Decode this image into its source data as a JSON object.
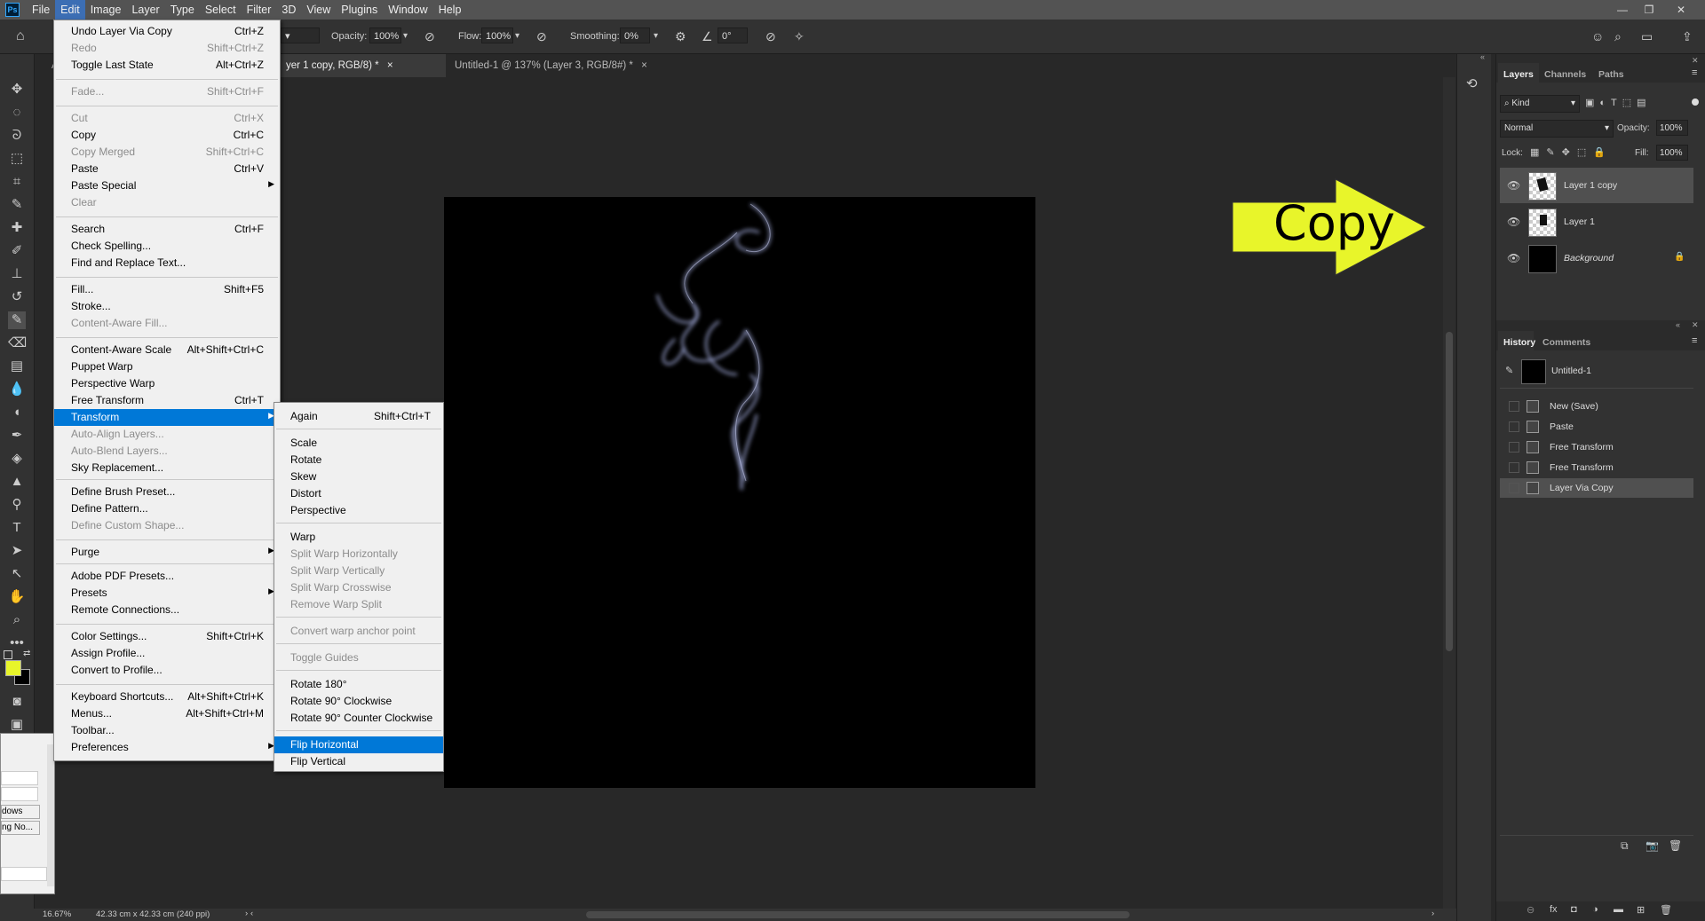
{
  "menubar": {
    "logo": "Ps",
    "items": [
      "File",
      "Edit",
      "Image",
      "Layer",
      "Type",
      "Select",
      "Filter",
      "3D",
      "View",
      "Plugins",
      "Window",
      "Help"
    ]
  },
  "options": {
    "opacity_label": "Opacity:",
    "opacity_value": "100%",
    "flow_label": "Flow:",
    "flow_value": "100%",
    "smoothing_label": "Smoothing:",
    "smoothing_value": "0%",
    "angle_value": "0°"
  },
  "tabs": [
    {
      "label": "A"
    },
    {
      "label": "yer 1 copy, RGB/8) *"
    },
    {
      "label": "Untitled-1 @ 137% (Layer 3, RGB/8#) *"
    }
  ],
  "edit_menu": {
    "items": [
      {
        "label": "Undo Layer Via Copy",
        "shortcut": "Ctrl+Z"
      },
      {
        "label": "Redo",
        "shortcut": "Shift+Ctrl+Z"
      },
      {
        "label": "Toggle Last State",
        "shortcut": "Alt+Ctrl+Z"
      },
      {
        "label": "Fade...",
        "shortcut": "Shift+Ctrl+F"
      },
      {
        "label": "Cut",
        "shortcut": "Ctrl+X"
      },
      {
        "label": "Copy",
        "shortcut": "Ctrl+C"
      },
      {
        "label": "Copy Merged",
        "shortcut": "Shift+Ctrl+C"
      },
      {
        "label": "Paste",
        "shortcut": "Ctrl+V"
      },
      {
        "label": "Paste Special",
        "shortcut": ""
      },
      {
        "label": "Clear",
        "shortcut": ""
      },
      {
        "label": "Search",
        "shortcut": "Ctrl+F"
      },
      {
        "label": "Check Spelling...",
        "shortcut": ""
      },
      {
        "label": "Find and Replace Text...",
        "shortcut": ""
      },
      {
        "label": "Fill...",
        "shortcut": "Shift+F5"
      },
      {
        "label": "Stroke...",
        "shortcut": ""
      },
      {
        "label": "Content-Aware Fill...",
        "shortcut": ""
      },
      {
        "label": "Content-Aware Scale",
        "shortcut": "Alt+Shift+Ctrl+C"
      },
      {
        "label": "Puppet Warp",
        "shortcut": ""
      },
      {
        "label": "Perspective Warp",
        "shortcut": ""
      },
      {
        "label": "Free Transform",
        "shortcut": "Ctrl+T"
      },
      {
        "label": "Transform",
        "shortcut": ""
      },
      {
        "label": "Auto-Align Layers...",
        "shortcut": ""
      },
      {
        "label": "Auto-Blend Layers...",
        "shortcut": ""
      },
      {
        "label": "Sky Replacement...",
        "shortcut": ""
      },
      {
        "label": "Define Brush Preset...",
        "shortcut": ""
      },
      {
        "label": "Define Pattern...",
        "shortcut": ""
      },
      {
        "label": "Define Custom Shape...",
        "shortcut": ""
      },
      {
        "label": "Purge",
        "shortcut": ""
      },
      {
        "label": "Adobe PDF Presets...",
        "shortcut": ""
      },
      {
        "label": "Presets",
        "shortcut": ""
      },
      {
        "label": "Remote Connections...",
        "shortcut": ""
      },
      {
        "label": "Color Settings...",
        "shortcut": "Shift+Ctrl+K"
      },
      {
        "label": "Assign Profile...",
        "shortcut": ""
      },
      {
        "label": "Convert to Profile...",
        "shortcut": ""
      },
      {
        "label": "Keyboard Shortcuts...",
        "shortcut": "Alt+Shift+Ctrl+K"
      },
      {
        "label": "Menus...",
        "shortcut": "Alt+Shift+Ctrl+M"
      },
      {
        "label": "Toolbar...",
        "shortcut": ""
      },
      {
        "label": "Preferences",
        "shortcut": ""
      }
    ]
  },
  "transform_menu": {
    "items": [
      {
        "label": "Again",
        "shortcut": "Shift+Ctrl+T"
      },
      {
        "label": "Scale"
      },
      {
        "label": "Rotate"
      },
      {
        "label": "Skew"
      },
      {
        "label": "Distort"
      },
      {
        "label": "Perspective"
      },
      {
        "label": "Warp"
      },
      {
        "label": "Split Warp Horizontally"
      },
      {
        "label": "Split Warp Vertically"
      },
      {
        "label": "Split Warp Crosswise"
      },
      {
        "label": "Remove Warp Split"
      },
      {
        "label": "Convert warp anchor point"
      },
      {
        "label": "Toggle Guides"
      },
      {
        "label": "Rotate 180°"
      },
      {
        "label": "Rotate 90° Clockwise"
      },
      {
        "label": "Rotate 90° Counter Clockwise"
      },
      {
        "label": "Flip Horizontal"
      },
      {
        "label": "Flip Vertical"
      }
    ]
  },
  "annotation": {
    "text": "Copy",
    "color": "#e8f52a"
  },
  "layers_panel": {
    "tabs": [
      "Layers",
      "Channels",
      "Paths"
    ],
    "kind": "Kind",
    "blend_mode": "Normal",
    "opacity_label": "Opacity:",
    "opacity_value": "100%",
    "lock_label": "Lock:",
    "fill_label": "Fill:",
    "fill_value": "100%",
    "layers": [
      {
        "name": "Layer 1 copy"
      },
      {
        "name": "Layer 1"
      },
      {
        "name": "Background"
      }
    ]
  },
  "history_panel": {
    "tabs": [
      "History",
      "Comments"
    ],
    "snapshot": "Untitled-1",
    "states": [
      "New (Save)",
      "Paste",
      "Free Transform",
      "Free Transform",
      "Layer Via Copy"
    ]
  },
  "partial_dialog": {
    "line1": "dows",
    "line2": "ng No..."
  },
  "status": {
    "zoom": "16.67%",
    "doc_info": "42.33 cm x 42.33 cm (240 ppi)"
  },
  "colors": {
    "foreground": "#e8f52a",
    "background": "#000000"
  }
}
